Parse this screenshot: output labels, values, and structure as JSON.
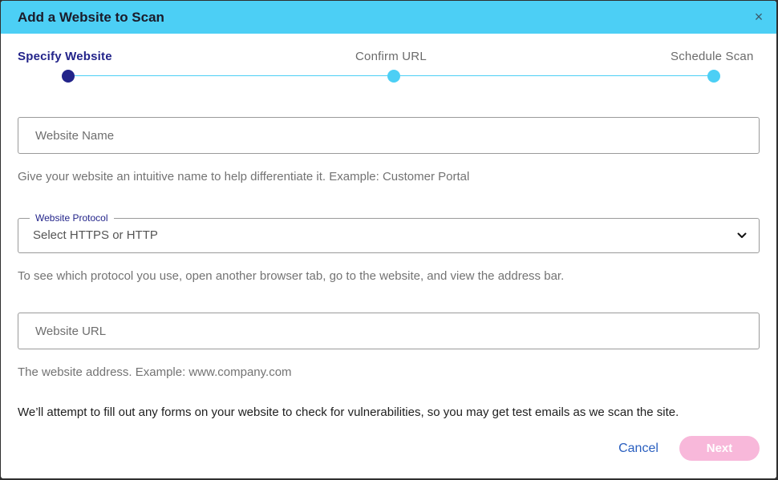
{
  "modal": {
    "title": "Add a Website to Scan",
    "close_glyph": "×"
  },
  "stepper": {
    "steps": [
      {
        "label": "Specify Website",
        "state": "active"
      },
      {
        "label": "Confirm URL",
        "state": "inactive"
      },
      {
        "label": "Schedule Scan",
        "state": "inactive"
      }
    ],
    "active_color": "#23248a",
    "inactive_color": "#4ccff5"
  },
  "form": {
    "website_name": {
      "placeholder": "Website Name",
      "value": "",
      "helper": "Give your website an intuitive name to help differentiate it. Example: Customer Portal"
    },
    "protocol": {
      "label": "Website Protocol",
      "value": "Select HTTPS or HTTP",
      "icon": "chevron-down-icon",
      "helper": "To see which protocol you use, open another browser tab, go to the website, and view the address bar."
    },
    "website_url": {
      "placeholder": "Website URL",
      "value": "",
      "helper": "The website address. Example: www.company.com"
    },
    "notice": "We’ll attempt to fill out any forms on your website to check for vulnerabilities, so you may get test emails as we scan the site."
  },
  "actions": {
    "cancel_label": "Cancel",
    "next_label": "Next",
    "next_enabled": false
  },
  "colors": {
    "header": "#4ccff5",
    "next_button": "#f8b8da",
    "cancel_link": "#2a5fbf"
  }
}
